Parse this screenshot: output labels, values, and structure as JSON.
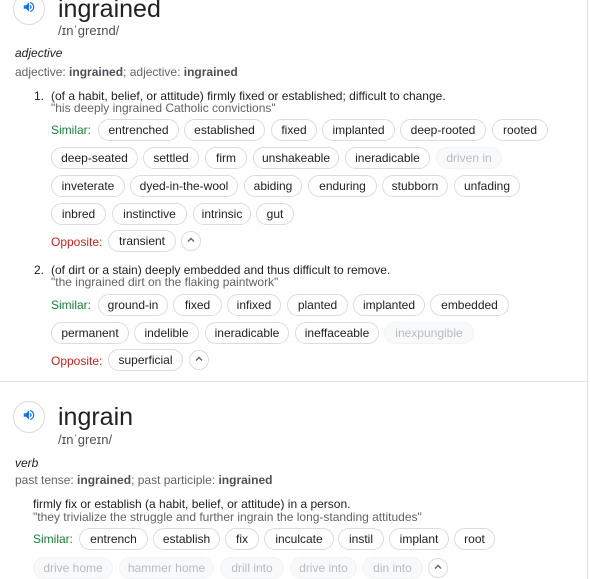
{
  "entry1": {
    "headword": "ingrained",
    "phonetic": "/ɪnˈɡreɪnd/",
    "pos": "adjective",
    "forms": {
      "label1": "adjective: ",
      "word1": "ingrained",
      "sep": "; ",
      "label2": "adjective: ",
      "word2": "ingrained"
    },
    "senses": [
      {
        "number": "1.",
        "definition": "(of a habit, belief, or attitude) firmly fixed or established; difficult to change.",
        "example": "\"his deeply ingrained Catholic convictions\"",
        "similar_label": "Similar:",
        "similar": [
          "entrenched",
          "established",
          "fixed",
          "implanted",
          "deep-rooted",
          "rooted",
          "deep-seated",
          "settled",
          "firm",
          "unshakeable",
          "ineradicable",
          "driven in",
          "inveterate",
          "dyed-in-the-wool",
          "abiding",
          "enduring",
          "stubborn",
          "unfading",
          "inbred",
          "instinctive",
          "intrinsic",
          "gut"
        ],
        "opposite_label": "Opposite:",
        "opposite": [
          "transient"
        ]
      },
      {
        "number": "2.",
        "definition": "(of dirt or a stain) deeply embedded and thus difficult to remove.",
        "example": "\"the ingrained dirt on the flaking paintwork\"",
        "similar_label": "Similar:",
        "similar": [
          "ground-in",
          "fixed",
          "infixed",
          "planted",
          "implanted",
          "embedded",
          "permanent",
          "indelible",
          "ineradicable",
          "ineffaceable",
          "inexpungible"
        ],
        "opposite_label": "Opposite:",
        "opposite": [
          "superficial"
        ]
      }
    ]
  },
  "entry2": {
    "headword": "ingrain",
    "phonetic": "/ɪnˈɡreɪn/",
    "pos": "verb",
    "forms": {
      "label1": "past tense: ",
      "word1": "ingrained",
      "sep": "; ",
      "label2": "past participle: ",
      "word2": "ingrained"
    },
    "sense": {
      "definition": "firmly fix or establish (a habit, belief, or attitude) in a person.",
      "example": "\"they trivialize the struggle and further ingrain the long-standing attitudes\"",
      "similar_label": "Similar:",
      "similar": [
        "entrench",
        "establish",
        "fix",
        "inculcate",
        "instil",
        "implant",
        "root",
        "drive home",
        "hammer home",
        "drill into",
        "drive into",
        "din into"
      ]
    }
  },
  "icons": {
    "speaker": "speaker-icon",
    "collapse": "chevron-up-icon"
  },
  "colors": {
    "similar": "#188038",
    "opposite": "#c5221f",
    "speaker": "#1a73e8"
  }
}
